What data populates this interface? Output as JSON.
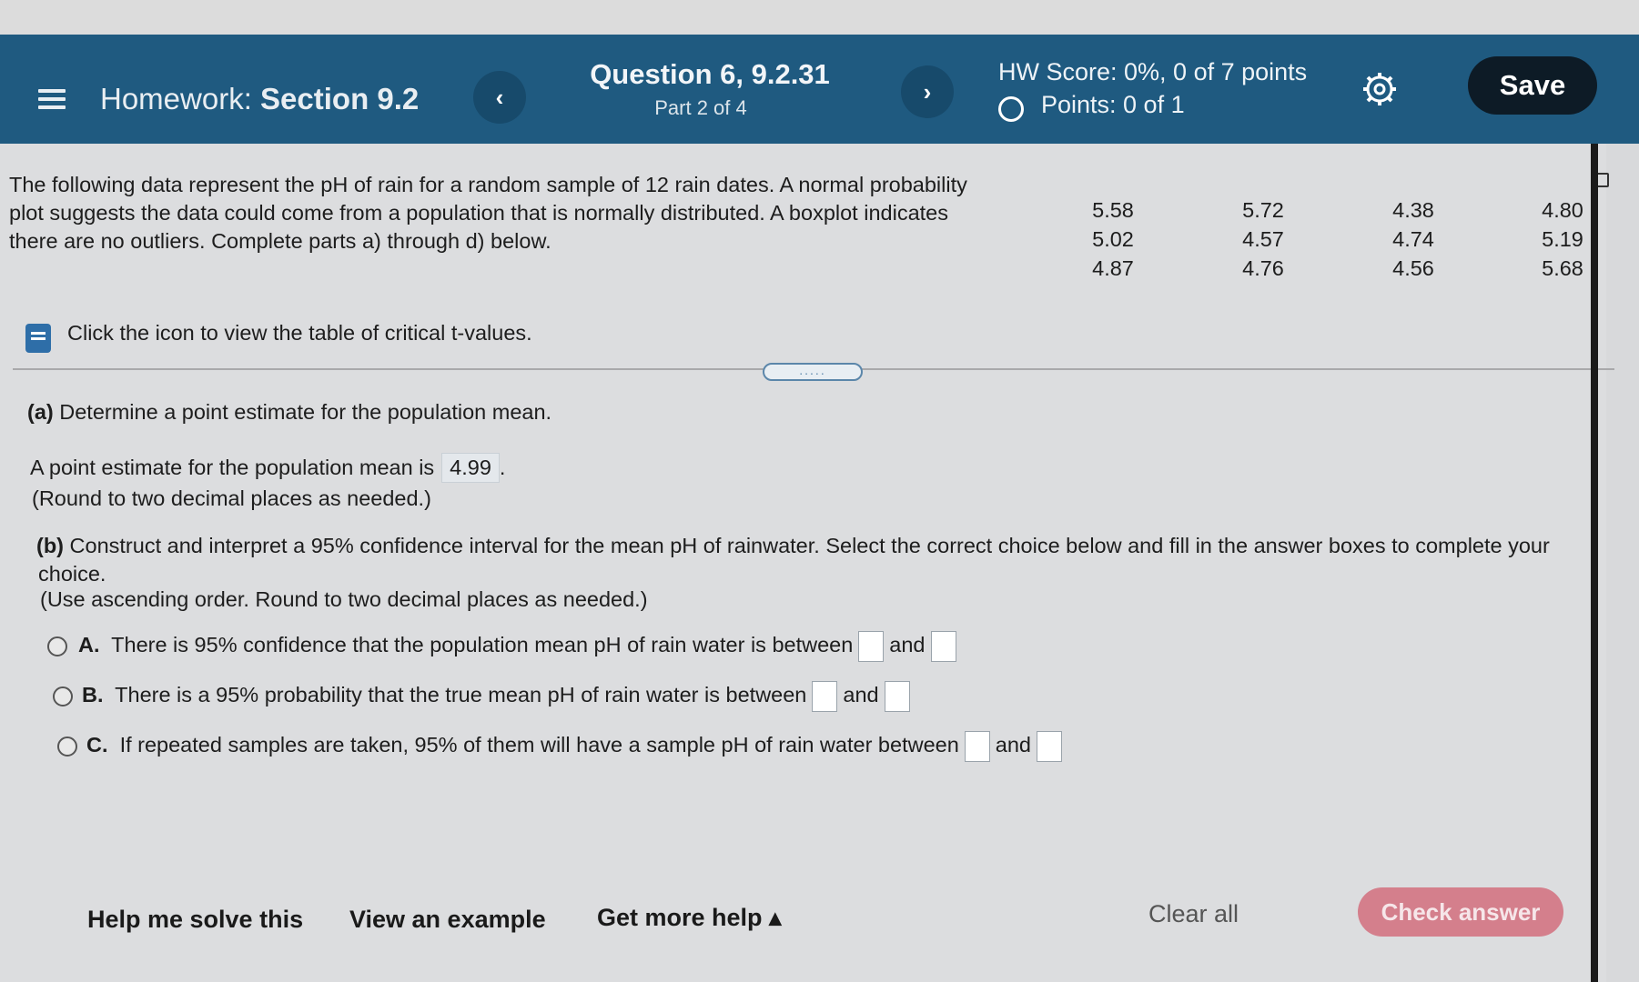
{
  "header": {
    "menu_icon": "hamburger-icon",
    "homework_prefix": "Homework:",
    "homework_section": "Section 9.2",
    "prev_icon": "chevron-left-icon",
    "prev_glyph": "‹",
    "next_icon": "chevron-right-icon",
    "next_glyph": "›",
    "question_title": "Question 6, 9.2.31",
    "question_part": "Part 2 of 4",
    "hw_score": "HW Score: 0%, 0 of 7 points",
    "points": "Points: 0 of 1",
    "settings_icon": "gear-icon",
    "save_label": "Save",
    "colors": {
      "header_bg": "#1f5a80",
      "save_bg": "#0d1b26"
    }
  },
  "problem": {
    "intro_line1": "The following data represent the pH of rain for a random sample of 12 rain dates. A normal probability",
    "intro_line2": "plot suggests the data could come from a population that is normally distributed. A boxplot indicates",
    "intro_line3": "there are no outliers. Complete parts a) through d) below.",
    "data_values": [
      "5.58",
      "5.72",
      "4.38",
      "4.80",
      "5.02",
      "4.57",
      "4.74",
      "5.19",
      "4.87",
      "4.76",
      "4.56",
      "5.68"
    ],
    "table_link_icon": "book-icon",
    "table_link_text": "Click the icon to view the table of critical t-values.",
    "divider_handle": "....."
  },
  "part_a": {
    "label": "(a)",
    "prompt": "Determine a point estimate for the population mean.",
    "answer_prefix": "A point estimate for the population mean is",
    "answer_value": "4.99",
    "answer_suffix": ".",
    "rounding_note": "(Round to two decimal places as needed.)"
  },
  "part_b": {
    "label": "(b)",
    "prompt_line1": "Construct and interpret a 95% confidence interval for the mean pH of rainwater. Select the correct choice below and fill in the answer boxes to complete your",
    "prompt_line2": "choice.",
    "rounding_note": "(Use ascending order. Round to two decimal places as needed.)",
    "choices": [
      {
        "letter": "A.",
        "text": "There is 95% confidence that the population mean pH of rain water is between",
        "and": "and"
      },
      {
        "letter": "B.",
        "text": "There is a 95% probability that the true mean pH of rain water is between",
        "and": "and"
      },
      {
        "letter": "C.",
        "text": "If repeated samples are taken, 95% of them will have a sample pH of rain water between",
        "and": "and"
      }
    ]
  },
  "footer": {
    "help_solve": "Help me solve this",
    "view_example": "View an example",
    "get_more_help": "Get more help ▴",
    "clear_all": "Clear all",
    "check_answer": "Check answer",
    "colors": {
      "check_bg": "#d47f8c"
    }
  }
}
